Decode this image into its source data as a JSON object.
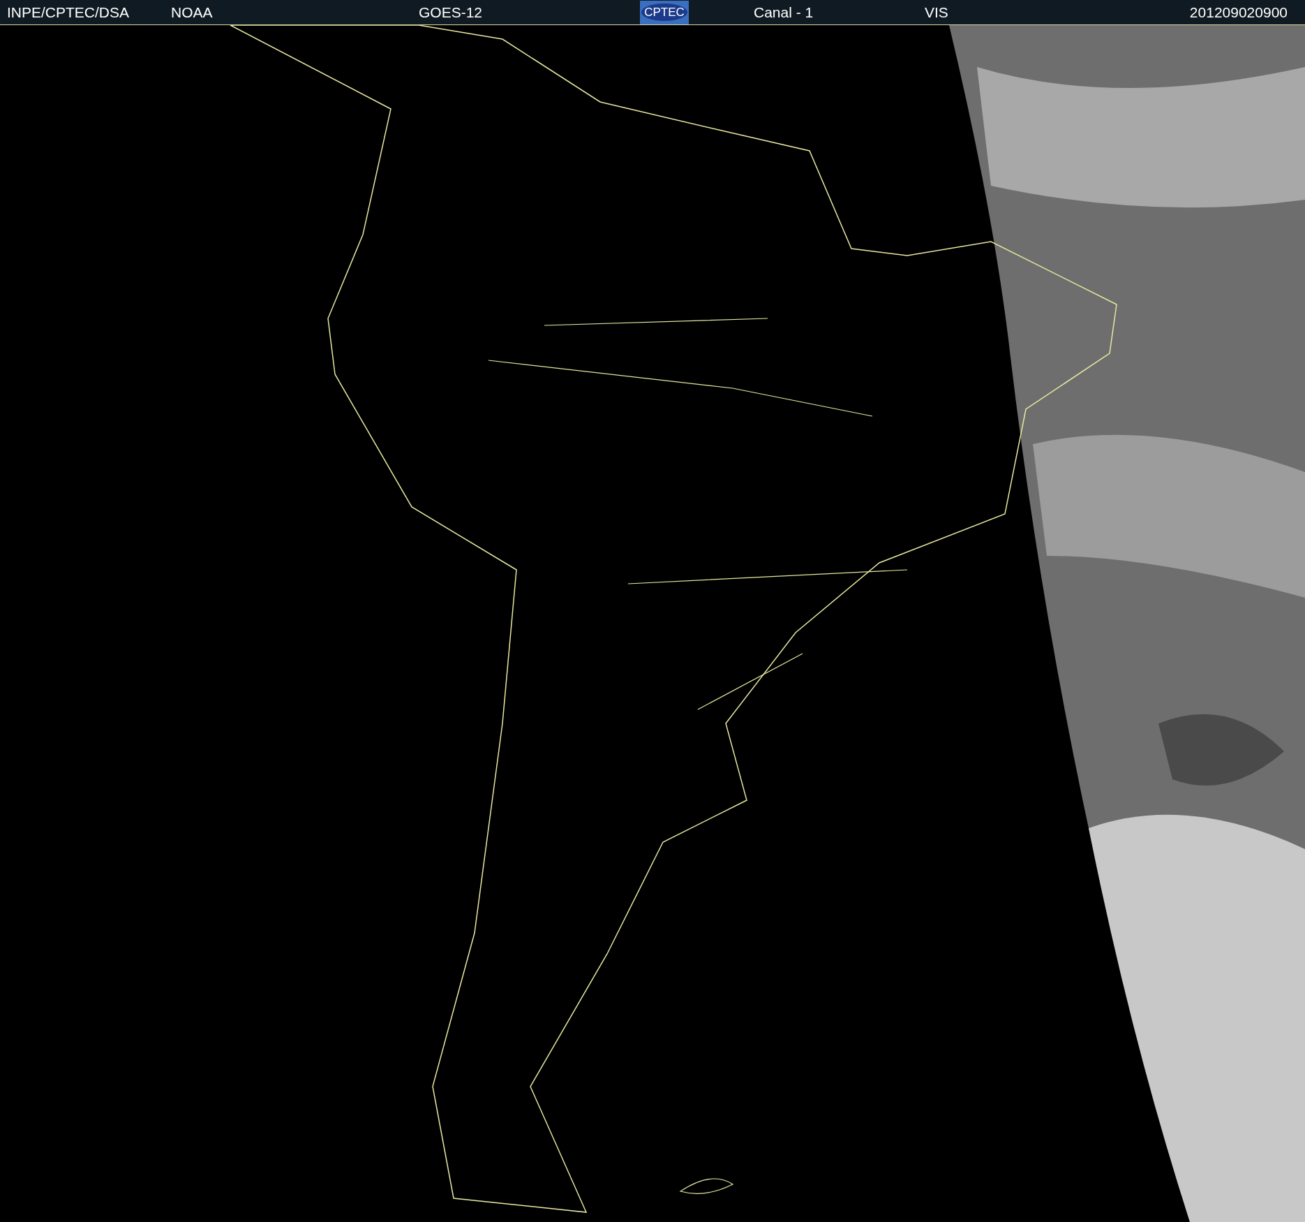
{
  "header": {
    "items": [
      "INPE/CPTEC/DSA",
      "NOAA",
      "GOES-12"
    ],
    "logo": "CPTEC",
    "channel": "Canal - 1",
    "band": "VIS",
    "timestamp": "201209020900"
  }
}
